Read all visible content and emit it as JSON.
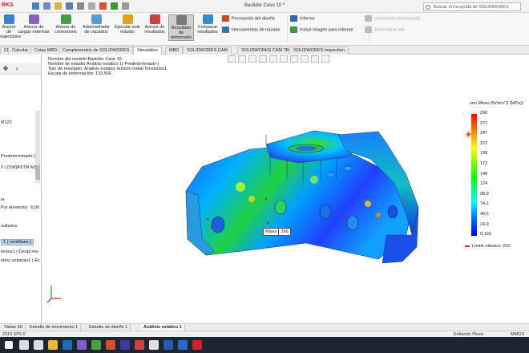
{
  "window": {
    "logo": "RKS",
    "title": "Bastidor Caso 10 *",
    "search_placeholder": "Buscar en la ayuda de SOLIDWORKS"
  },
  "ribbon": {
    "buttons": [
      {
        "label": "Asesor de sujeciones",
        "icon": "fixture-icon",
        "color": "#3a7fd0"
      },
      {
        "label": "Asesor de cargas externas",
        "icon": "load-icon",
        "color": "#8a5fc8"
      },
      {
        "label": "Asesor de conexiones",
        "icon": "connection-icon",
        "color": "#4a9a4a"
      },
      {
        "label": "Administrador de vaciados",
        "icon": "shell-icon",
        "color": "#5a9ad8"
      },
      {
        "label": "Ejecutar este estudio",
        "icon": "run-icon",
        "color": "#e0a020"
      },
      {
        "label": "Asesor de resultados",
        "icon": "results-advisor-icon",
        "color": "#d04040"
      },
      {
        "label": "Resultado de deformado",
        "icon": "deformed-icon",
        "color": "#7a7a7a"
      },
      {
        "label": "Comparar resultados",
        "icon": "compare-icon",
        "color": "#3a8ad0"
      }
    ],
    "small": [
      {
        "label": "Percepción del diseño",
        "icon": "design-insight-icon",
        "color": "#c05020"
      },
      {
        "label": "Herramientas de trazado",
        "icon": "plot-tools-icon",
        "color": "#3a6fc0"
      },
      {
        "label": "Informe",
        "icon": "report-icon",
        "color": "#2a6ab0"
      },
      {
        "label": "Incluir imagen para informe",
        "icon": "include-image-icon",
        "color": "#3a9a3a"
      },
      {
        "label": "Simulación descargada",
        "icon": "simulation-download-icon",
        "color": "#bbbbbb"
      },
      {
        "label": "Administrar red",
        "icon": "network-icon",
        "color": "#bbbbbb"
      }
    ]
  },
  "tabs": [
    "CE",
    "Calcular",
    "Cotac.MBD",
    "Complementos de SOLIDWORKS",
    "Simulation",
    "MBD",
    "SOLIDWORKS CAM",
    "SOLIDWORKS CAM TBM",
    "SOLIDWORKS Inspection"
  ],
  "left_panel": {
    "item_material": "M122",
    "item_predet": "Predeterminado-)",
    "item_solid": "0 (-[SW]ASTM A36",
    "item_ia": "ia",
    "item_element": "Por elemento: -5,00",
    "item_results": "sultados",
    "item_selected": "1 (-vonMises-)",
    "item_disp": "ientos1 (-Despl res-",
    "item_strain": "ones unitarias1 (-Ec"
  },
  "viewport": {
    "info": [
      "Nombre del modelo:Bastidor Caso 10",
      "Nombre de estudio:Análisis estático 1(-Predeterminado-)",
      "Tipo de resultado: Análisis estático tensión nodal Tensiones1",
      "Escala de deformación: 133,566"
    ],
    "probe_label": "Mises",
    "probe_value": "296"
  },
  "legend": {
    "title": "von Mises (N/mm^2 (MPa))",
    "values": [
      "296",
      "272",
      "247",
      "222",
      "198",
      "173",
      "148",
      "124",
      "98,9",
      "74,2",
      "49,6",
      "24,9",
      "0,195"
    ],
    "elastic_limit": "Límite elástico: 250"
  },
  "bottom_tabs": [
    "Vistas 3D",
    "Estudio de movimiento 1",
    "Estudio de diseño 1",
    "Análisis estático 1"
  ],
  "status": {
    "left": "2019 SP0.0",
    "mode": "Editando Pieza",
    "units": "MMGS"
  },
  "taskbar": {
    "icons": [
      "windows-icon",
      "search-icon",
      "task-view-icon",
      "explorer-icon",
      "steam-icon",
      "app-icon",
      "minecraft-icon",
      "app-icon",
      "app-icon",
      "app-icon",
      "chrome-icon",
      "word-icon",
      "app-icon",
      "solidworks-icon"
    ]
  }
}
